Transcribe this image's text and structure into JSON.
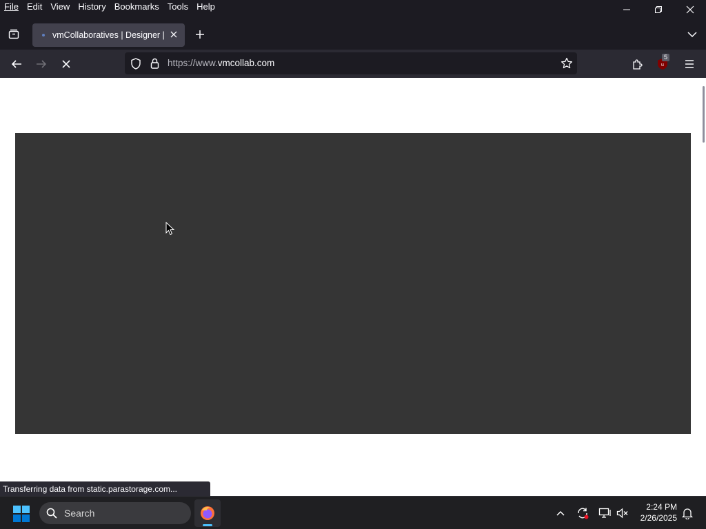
{
  "menubar": {
    "items": [
      "File",
      "Edit",
      "View",
      "History",
      "Bookmarks",
      "Tools",
      "Help"
    ]
  },
  "tab": {
    "title": "vmCollaboratives | Designer | Web",
    "title_visible": "vmCollaboratives | Designer | W"
  },
  "address": {
    "protocol": "https://www.",
    "domain": "vmcollab.com"
  },
  "extensions": {
    "badge_count": "5"
  },
  "status_bar": {
    "text": "Transferring data from static.parastorage.com..."
  },
  "taskbar": {
    "search_label": "Search",
    "time": "2:24 PM",
    "date": "2/26/2025"
  },
  "colors": {
    "browser_chrome": "#1c1b22",
    "toolbar": "#2b2a33",
    "active_tab": "#42414d",
    "hero_block": "#353535",
    "page_bg": "#ffffff"
  }
}
